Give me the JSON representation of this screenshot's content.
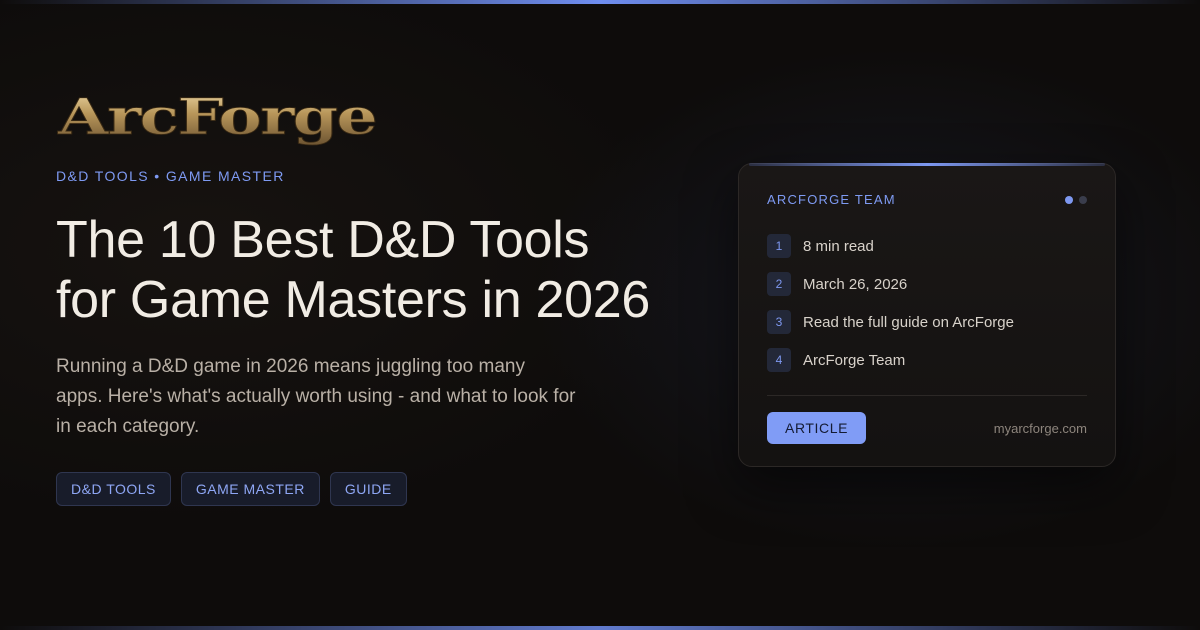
{
  "brand": {
    "name": "ArcForge"
  },
  "kicker": "D&D TOOLS • GAME MASTER",
  "title": "The 10 Best D&D Tools for Game Masters in 2026",
  "description": "Running a D&D game in 2026 means juggling too many apps. Here's what's actually worth using - and what to look for in each category.",
  "tags": [
    "D&D TOOLS",
    "GAME MASTER",
    "GUIDE"
  ],
  "card": {
    "author": "ARCFORGE TEAM",
    "items": [
      {
        "num": "1",
        "text": "8 min read"
      },
      {
        "num": "2",
        "text": "March 26, 2026"
      },
      {
        "num": "3",
        "text": "Read the full guide on ArcForge"
      },
      {
        "num": "4",
        "text": "ArcForge Team"
      }
    ],
    "badge": "ARTICLE",
    "site": "myarcforge.com"
  },
  "colors": {
    "accent": "#7e9af2",
    "badge_bg": "#809cf6",
    "background": "#0e0c0b",
    "logo_gold": "#b8965a"
  },
  "icons": [
    "pagination-dots-icon"
  ]
}
